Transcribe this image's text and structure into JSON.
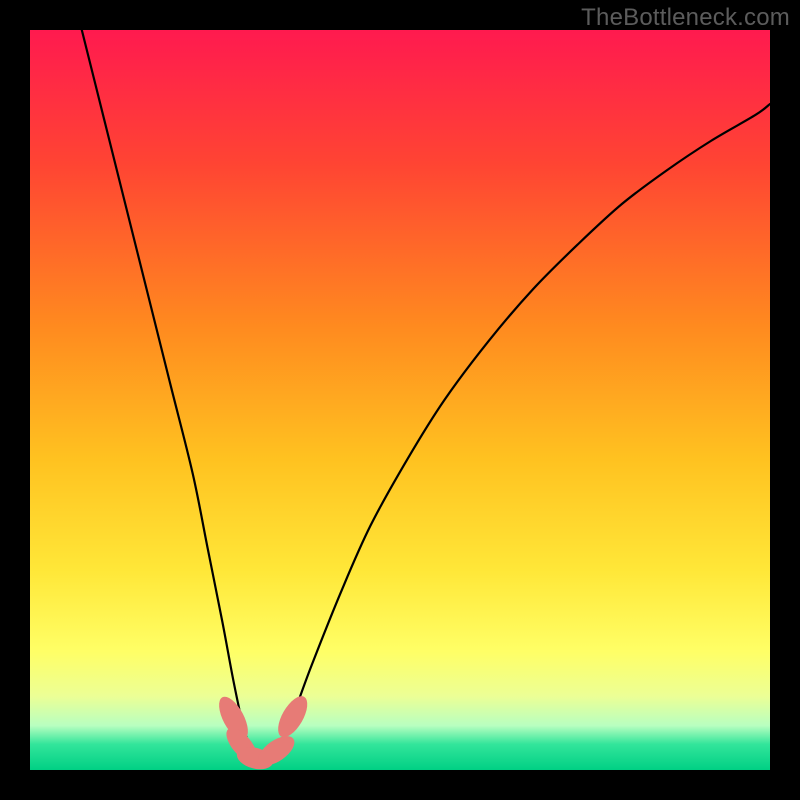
{
  "watermark": "TheBottleneck.com",
  "chart_data": {
    "type": "line",
    "title": "",
    "xlabel": "",
    "ylabel": "",
    "xlim": [
      0,
      100
    ],
    "ylim": [
      0,
      100
    ],
    "grid": false,
    "legend": false,
    "gradient_stops": [
      {
        "offset": 0.0,
        "color": "#ff1a4f"
      },
      {
        "offset": 0.18,
        "color": "#ff4433"
      },
      {
        "offset": 0.4,
        "color": "#ff8a1f"
      },
      {
        "offset": 0.58,
        "color": "#ffc220"
      },
      {
        "offset": 0.73,
        "color": "#ffe738"
      },
      {
        "offset": 0.84,
        "color": "#ffff66"
      },
      {
        "offset": 0.9,
        "color": "#ecff95"
      },
      {
        "offset": 0.94,
        "color": "#b8ffc0"
      },
      {
        "offset": 0.965,
        "color": "#33e59b"
      },
      {
        "offset": 1.0,
        "color": "#00d084"
      }
    ],
    "series": [
      {
        "name": "bottleneck-curve",
        "x": [
          7,
          10,
          13,
          16,
          19,
          22,
          24,
          26,
          27.5,
          28.8,
          30,
          31.5,
          33,
          35,
          38,
          42,
          46,
          51,
          56,
          62,
          68,
          74,
          80,
          86,
          92,
          98,
          100
        ],
        "y": [
          100,
          88,
          76,
          64,
          52,
          40,
          30,
          20,
          12,
          6,
          2.5,
          1.5,
          2.5,
          6,
          14,
          24,
          33,
          42,
          50,
          58,
          65,
          71,
          76.5,
          81,
          85,
          88.5,
          90
        ]
      }
    ],
    "markers": [
      {
        "x": 27.5,
        "y": 7.0,
        "rx": 1.4,
        "ry": 3.2,
        "angle": -28
      },
      {
        "x": 28.6,
        "y": 3.4,
        "rx": 1.3,
        "ry": 2.8,
        "angle": -40
      },
      {
        "x": 30.4,
        "y": 1.6,
        "rx": 1.4,
        "ry": 2.5,
        "angle": -75
      },
      {
        "x": 33.3,
        "y": 2.6,
        "rx": 1.4,
        "ry": 2.8,
        "angle": 55
      },
      {
        "x": 35.5,
        "y": 7.2,
        "rx": 1.4,
        "ry": 3.1,
        "angle": 30
      }
    ],
    "marker_color": "#e77b76"
  }
}
